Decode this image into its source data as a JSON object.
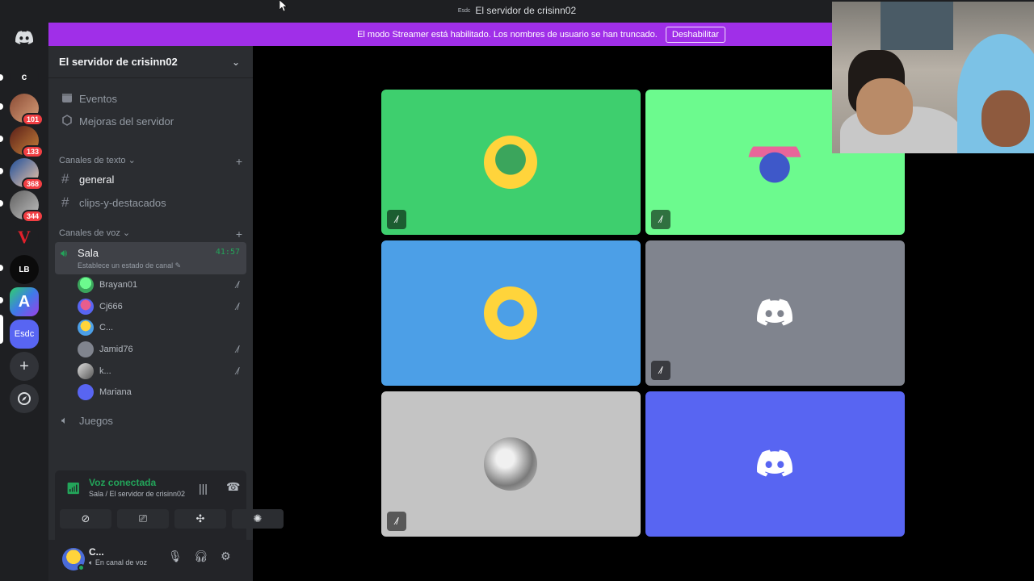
{
  "window": {
    "title": "El servidor de crisinn02",
    "title_icon_text": "Esdc"
  },
  "streamer_banner": {
    "text": "El modo Streamer está habilitado. Los nombres de usuario se han truncado.",
    "button_label": "Deshabilitar",
    "color": "#a02fe8"
  },
  "server_rail": {
    "items": [
      {
        "label": "",
        "icon": "discord-home-icon"
      },
      {
        "label": "c",
        "icon": ""
      },
      {
        "label": "",
        "badge": "101"
      },
      {
        "label": "",
        "badge": "133"
      },
      {
        "label": "",
        "badge": "368"
      },
      {
        "label": "",
        "badge": "344"
      },
      {
        "label": "V",
        "icon": ""
      },
      {
        "label": "LB",
        "icon": ""
      },
      {
        "label": "A",
        "icon": ""
      },
      {
        "label": "Esdc",
        "icon": ""
      },
      {
        "label": "+",
        "icon": "add-server-icon"
      },
      {
        "label": "",
        "icon": "explore-icon"
      }
    ]
  },
  "sidebar": {
    "server_name": "El servidor de crisinn02",
    "menu": [
      {
        "label": "Eventos",
        "icon": "calendar-icon"
      },
      {
        "label": "Mejoras del servidor",
        "icon": "boost-icon"
      }
    ],
    "text_category": "Canales de texto",
    "text_channels": [
      {
        "label": "general",
        "active": true
      },
      {
        "label": "clips-y-destacados",
        "active": false
      }
    ],
    "voice_category": "Canales de voz",
    "voice_channel": {
      "name": "Sala",
      "timer": "41:57",
      "status": "Establece un estado de canal"
    },
    "voice_users": [
      {
        "name": "Brayan01",
        "muted": true,
        "avatar_color": "#3ba55c"
      },
      {
        "name": "Cj666",
        "muted": true,
        "avatar_color": "#5865f2"
      },
      {
        "name": "C...",
        "muted": false,
        "avatar_color": "#ffd43b"
      },
      {
        "name": "Jamid76",
        "muted": true,
        "avatar_color": "#80848e"
      },
      {
        "name": "k...",
        "muted": true,
        "avatar_color": "#9a9a9a"
      },
      {
        "name": "Mariana",
        "muted": false,
        "avatar_color": "#5865f2"
      }
    ],
    "other_voice_channel": "Juegos"
  },
  "voice_panel": {
    "title": "Voz conectada",
    "subtitle": "Sala / El servidor de crisinn02"
  },
  "user_panel": {
    "name": "C...",
    "status": "En canal de voz"
  },
  "video_tiles": [
    {
      "bg": "#3ecf6e",
      "avatar": "green",
      "muted": true
    },
    {
      "bg": "#6cfa8e",
      "avatar": "house",
      "muted": true
    },
    {
      "bg": "#4c9fe7",
      "avatar": "yellow",
      "muted": false
    },
    {
      "bg": "#80848e",
      "avatar": "discord",
      "muted": true
    },
    {
      "bg": "#c4c4c4",
      "avatar": "photo",
      "muted": true
    },
    {
      "bg": "#5865f2",
      "avatar": "discord",
      "muted": false
    }
  ]
}
